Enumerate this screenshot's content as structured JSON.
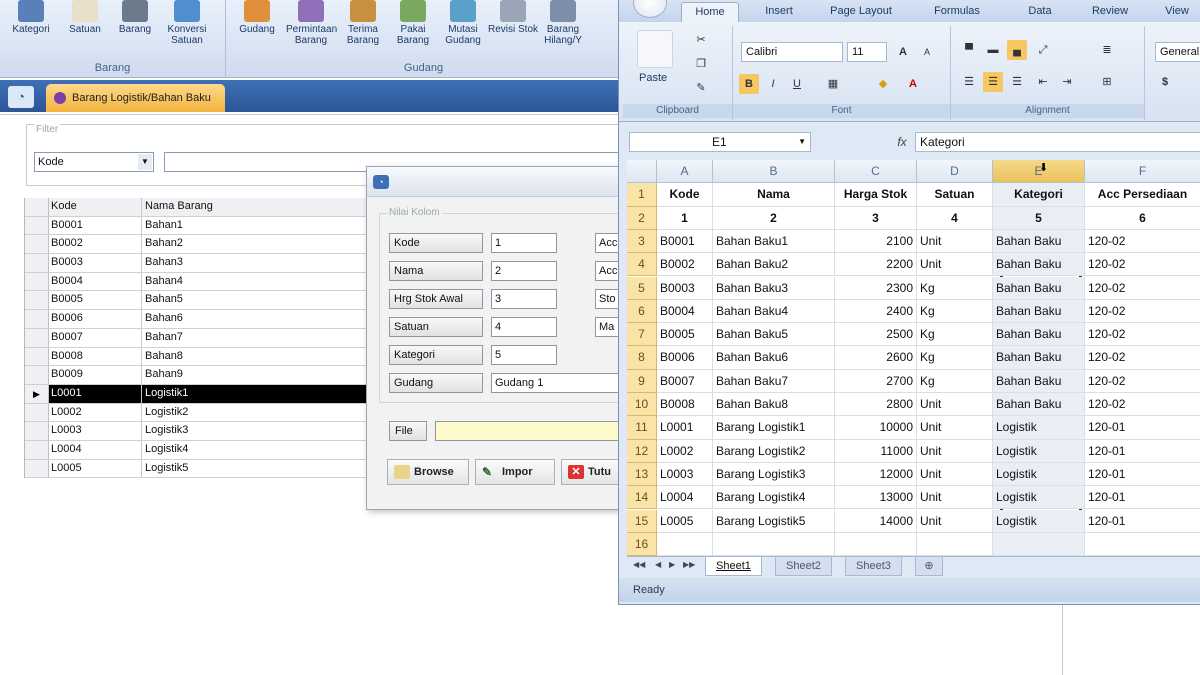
{
  "app": {
    "ribbon": {
      "groups": [
        {
          "label": "Barang",
          "buttons": [
            "Kategori",
            "Satuan",
            "Barang",
            "Konversi Satuan"
          ]
        },
        {
          "label": "Gudang",
          "buttons": [
            "Gudang",
            "Permintaan Barang",
            "Terima Barang",
            "Pakai Barang",
            "Mutasi Gudang",
            "Revisi Stok",
            "Barang Hilang/Y"
          ]
        }
      ]
    },
    "doc_tab": "Barang Logistik/Bahan Baku",
    "filter": {
      "legend": "Filter",
      "select_value": "Kode",
      "input_value": ""
    },
    "grid": {
      "headers": [
        "Kode",
        "Nama Barang"
      ],
      "rows": [
        {
          "kode": "B0001",
          "nama": "Bahan1"
        },
        {
          "kode": "B0002",
          "nama": "Bahan2"
        },
        {
          "kode": "B0003",
          "nama": "Bahan3"
        },
        {
          "kode": "B0004",
          "nama": "Bahan4"
        },
        {
          "kode": "B0005",
          "nama": "Bahan5"
        },
        {
          "kode": "B0006",
          "nama": "Bahan6"
        },
        {
          "kode": "B0007",
          "nama": "Bahan7"
        },
        {
          "kode": "B0008",
          "nama": "Bahan8"
        },
        {
          "kode": "B0009",
          "nama": "Bahan9"
        },
        {
          "kode": "L0001",
          "nama": "Logistik1"
        },
        {
          "kode": "L0002",
          "nama": "Logistik2"
        },
        {
          "kode": "L0003",
          "nama": "Logistik3"
        },
        {
          "kode": "L0004",
          "nama": "Logistik4"
        },
        {
          "kode": "L0005",
          "nama": "Logistik5"
        }
      ],
      "selected_index": 9,
      "selected_marker": "▶"
    }
  },
  "dialog": {
    "group_legend": "Nilai Kolom",
    "fields": [
      {
        "label": "Kode",
        "value": "1",
        "side": "Acc"
      },
      {
        "label": "Nama",
        "value": "2",
        "side": "Acc"
      },
      {
        "label": "Hrg Stok Awal",
        "value": "3",
        "side": "Sto"
      },
      {
        "label": "Satuan",
        "value": "4",
        "side": "Ma"
      },
      {
        "label": "Kategori",
        "value": "5",
        "side": ""
      },
      {
        "label": "Gudang",
        "value": "Gudang 1",
        "side": ""
      }
    ],
    "file_label": "File",
    "file_value": "",
    "buttons": [
      "Browse",
      "Impor",
      "Tutu"
    ]
  },
  "excel": {
    "tabs": [
      "Home",
      "Insert",
      "Page Layout",
      "Formulas",
      "Data",
      "Review",
      "View"
    ],
    "active_tab": "Home",
    "ribbon": {
      "paste_label": "Paste",
      "font_name": "Calibri",
      "font_size": "11",
      "number_format": "General",
      "group_labels": [
        "Clipboard",
        "Font",
        "Alignment"
      ]
    },
    "name_box": "E1",
    "formula": "Kategori",
    "columns": [
      "A",
      "B",
      "C",
      "D",
      "E",
      "F"
    ],
    "rows": [
      [
        "Kode",
        "Nama",
        "Harga Stok",
        "Satuan",
        "Kategori",
        "Acc Persediaan"
      ],
      [
        "1",
        "2",
        "3",
        "4",
        "5",
        "6"
      ],
      [
        "B0001",
        "Bahan Baku1",
        "2100",
        "Unit",
        "Bahan Baku",
        "120-02"
      ],
      [
        "B0002",
        "Bahan Baku2",
        "2200",
        "Unit",
        "Bahan Baku",
        "120-02"
      ],
      [
        "B0003",
        "Bahan Baku3",
        "2300",
        "Kg",
        "Bahan Baku",
        "120-02"
      ],
      [
        "B0004",
        "Bahan Baku4",
        "2400",
        "Kg",
        "Bahan Baku",
        "120-02"
      ],
      [
        "B0005",
        "Bahan Baku5",
        "2500",
        "Kg",
        "Bahan Baku",
        "120-02"
      ],
      [
        "B0006",
        "Bahan Baku6",
        "2600",
        "Kg",
        "Bahan Baku",
        "120-02"
      ],
      [
        "B0007",
        "Bahan Baku7",
        "2700",
        "Kg",
        "Bahan Baku",
        "120-02"
      ],
      [
        "B0008",
        "Bahan Baku8",
        "2800",
        "Unit",
        "Bahan Baku",
        "120-02"
      ],
      [
        "L0001",
        "Barang Logistik1",
        "10000",
        "Unit",
        "Logistik",
        "120-01"
      ],
      [
        "L0002",
        "Barang Logistik2",
        "11000",
        "Unit",
        "Logistik",
        "120-01"
      ],
      [
        "L0003",
        "Barang Logistik3",
        "12000",
        "Unit",
        "Logistik",
        "120-01"
      ],
      [
        "L0004",
        "Barang Logistik4",
        "13000",
        "Unit",
        "Logistik",
        "120-01"
      ],
      [
        "L0005",
        "Barang Logistik5",
        "14000",
        "Unit",
        "Logistik",
        "120-01"
      ],
      [
        "",
        "",
        "",
        "",
        "",
        ""
      ]
    ],
    "sheets": [
      "Sheet1",
      "Sheet2",
      "Sheet3"
    ],
    "active_sheet": "Sheet1",
    "status": "Ready"
  }
}
